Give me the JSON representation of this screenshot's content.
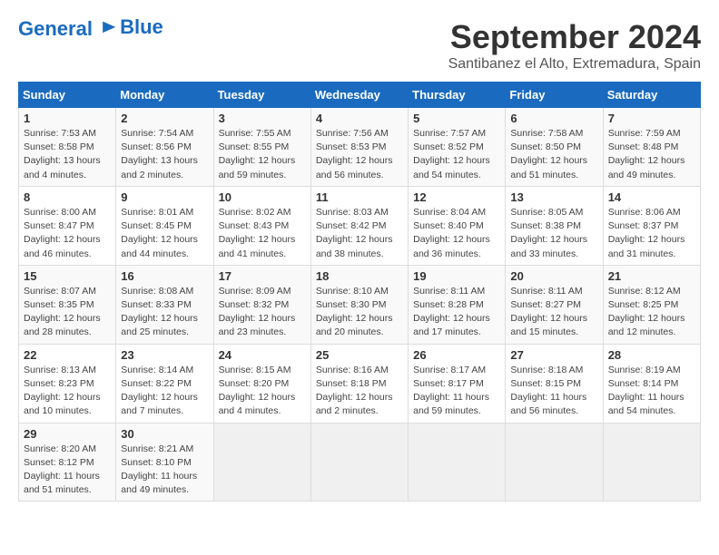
{
  "header": {
    "logo_line1": "General",
    "logo_line2": "Blue",
    "month": "September 2024",
    "location": "Santibanez el Alto, Extremadura, Spain"
  },
  "days_of_week": [
    "Sunday",
    "Monday",
    "Tuesday",
    "Wednesday",
    "Thursday",
    "Friday",
    "Saturday"
  ],
  "weeks": [
    [
      {
        "day": 1,
        "detail": "Sunrise: 7:53 AM\nSunset: 8:58 PM\nDaylight: 13 hours\nand 4 minutes."
      },
      {
        "day": 2,
        "detail": "Sunrise: 7:54 AM\nSunset: 8:56 PM\nDaylight: 13 hours\nand 2 minutes."
      },
      {
        "day": 3,
        "detail": "Sunrise: 7:55 AM\nSunset: 8:55 PM\nDaylight: 12 hours\nand 59 minutes."
      },
      {
        "day": 4,
        "detail": "Sunrise: 7:56 AM\nSunset: 8:53 PM\nDaylight: 12 hours\nand 56 minutes."
      },
      {
        "day": 5,
        "detail": "Sunrise: 7:57 AM\nSunset: 8:52 PM\nDaylight: 12 hours\nand 54 minutes."
      },
      {
        "day": 6,
        "detail": "Sunrise: 7:58 AM\nSunset: 8:50 PM\nDaylight: 12 hours\nand 51 minutes."
      },
      {
        "day": 7,
        "detail": "Sunrise: 7:59 AM\nSunset: 8:48 PM\nDaylight: 12 hours\nand 49 minutes."
      }
    ],
    [
      {
        "day": 8,
        "detail": "Sunrise: 8:00 AM\nSunset: 8:47 PM\nDaylight: 12 hours\nand 46 minutes."
      },
      {
        "day": 9,
        "detail": "Sunrise: 8:01 AM\nSunset: 8:45 PM\nDaylight: 12 hours\nand 44 minutes."
      },
      {
        "day": 10,
        "detail": "Sunrise: 8:02 AM\nSunset: 8:43 PM\nDaylight: 12 hours\nand 41 minutes."
      },
      {
        "day": 11,
        "detail": "Sunrise: 8:03 AM\nSunset: 8:42 PM\nDaylight: 12 hours\nand 38 minutes."
      },
      {
        "day": 12,
        "detail": "Sunrise: 8:04 AM\nSunset: 8:40 PM\nDaylight: 12 hours\nand 36 minutes."
      },
      {
        "day": 13,
        "detail": "Sunrise: 8:05 AM\nSunset: 8:38 PM\nDaylight: 12 hours\nand 33 minutes."
      },
      {
        "day": 14,
        "detail": "Sunrise: 8:06 AM\nSunset: 8:37 PM\nDaylight: 12 hours\nand 31 minutes."
      }
    ],
    [
      {
        "day": 15,
        "detail": "Sunrise: 8:07 AM\nSunset: 8:35 PM\nDaylight: 12 hours\nand 28 minutes."
      },
      {
        "day": 16,
        "detail": "Sunrise: 8:08 AM\nSunset: 8:33 PM\nDaylight: 12 hours\nand 25 minutes."
      },
      {
        "day": 17,
        "detail": "Sunrise: 8:09 AM\nSunset: 8:32 PM\nDaylight: 12 hours\nand 23 minutes."
      },
      {
        "day": 18,
        "detail": "Sunrise: 8:10 AM\nSunset: 8:30 PM\nDaylight: 12 hours\nand 20 minutes."
      },
      {
        "day": 19,
        "detail": "Sunrise: 8:11 AM\nSunset: 8:28 PM\nDaylight: 12 hours\nand 17 minutes."
      },
      {
        "day": 20,
        "detail": "Sunrise: 8:11 AM\nSunset: 8:27 PM\nDaylight: 12 hours\nand 15 minutes."
      },
      {
        "day": 21,
        "detail": "Sunrise: 8:12 AM\nSunset: 8:25 PM\nDaylight: 12 hours\nand 12 minutes."
      }
    ],
    [
      {
        "day": 22,
        "detail": "Sunrise: 8:13 AM\nSunset: 8:23 PM\nDaylight: 12 hours\nand 10 minutes."
      },
      {
        "day": 23,
        "detail": "Sunrise: 8:14 AM\nSunset: 8:22 PM\nDaylight: 12 hours\nand 7 minutes."
      },
      {
        "day": 24,
        "detail": "Sunrise: 8:15 AM\nSunset: 8:20 PM\nDaylight: 12 hours\nand 4 minutes."
      },
      {
        "day": 25,
        "detail": "Sunrise: 8:16 AM\nSunset: 8:18 PM\nDaylight: 12 hours\nand 2 minutes."
      },
      {
        "day": 26,
        "detail": "Sunrise: 8:17 AM\nSunset: 8:17 PM\nDaylight: 11 hours\nand 59 minutes."
      },
      {
        "day": 27,
        "detail": "Sunrise: 8:18 AM\nSunset: 8:15 PM\nDaylight: 11 hours\nand 56 minutes."
      },
      {
        "day": 28,
        "detail": "Sunrise: 8:19 AM\nSunset: 8:14 PM\nDaylight: 11 hours\nand 54 minutes."
      }
    ],
    [
      {
        "day": 29,
        "detail": "Sunrise: 8:20 AM\nSunset: 8:12 PM\nDaylight: 11 hours\nand 51 minutes."
      },
      {
        "day": 30,
        "detail": "Sunrise: 8:21 AM\nSunset: 8:10 PM\nDaylight: 11 hours\nand 49 minutes."
      },
      {
        "day": null,
        "detail": ""
      },
      {
        "day": null,
        "detail": ""
      },
      {
        "day": null,
        "detail": ""
      },
      {
        "day": null,
        "detail": ""
      },
      {
        "day": null,
        "detail": ""
      }
    ]
  ]
}
